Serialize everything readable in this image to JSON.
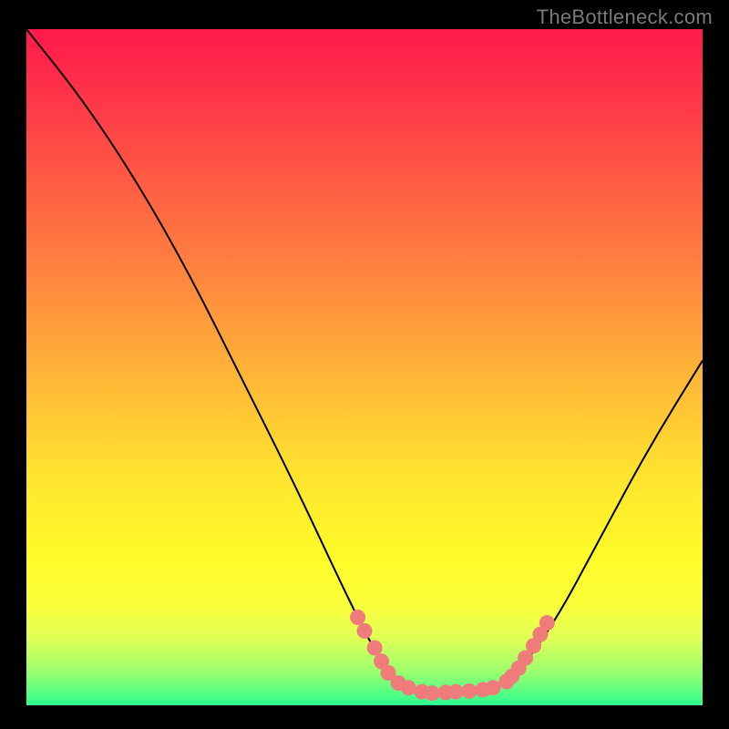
{
  "watermark": "TheBottleneck.com",
  "chart_data": {
    "type": "line",
    "title": "",
    "xlabel": "",
    "ylabel": "",
    "xlim": [
      0,
      100
    ],
    "ylim": [
      0,
      100
    ],
    "curve": [
      {
        "x": 0,
        "y": 100
      },
      {
        "x": 8,
        "y": 90
      },
      {
        "x": 16,
        "y": 78
      },
      {
        "x": 24,
        "y": 64
      },
      {
        "x": 32,
        "y": 48
      },
      {
        "x": 40,
        "y": 32
      },
      {
        "x": 47,
        "y": 17
      },
      {
        "x": 52,
        "y": 7
      },
      {
        "x": 56,
        "y": 2.5
      },
      {
        "x": 60,
        "y": 1.8
      },
      {
        "x": 64,
        "y": 2.0
      },
      {
        "x": 68,
        "y": 2.4
      },
      {
        "x": 72,
        "y": 4
      },
      {
        "x": 78,
        "y": 12
      },
      {
        "x": 85,
        "y": 25
      },
      {
        "x": 92,
        "y": 38
      },
      {
        "x": 100,
        "y": 51
      }
    ],
    "highlight_dots": [
      {
        "x": 49,
        "y": 13
      },
      {
        "x": 50,
        "y": 11
      },
      {
        "x": 51.5,
        "y": 8.5
      },
      {
        "x": 52.5,
        "y": 6.5
      },
      {
        "x": 53.5,
        "y": 4.8
      },
      {
        "x": 55,
        "y": 3.3
      },
      {
        "x": 56.5,
        "y": 2.6
      },
      {
        "x": 58.5,
        "y": 2.0
      },
      {
        "x": 60,
        "y": 1.8
      },
      {
        "x": 62,
        "y": 1.9
      },
      {
        "x": 63.5,
        "y": 2.0
      },
      {
        "x": 65.5,
        "y": 2.1
      },
      {
        "x": 67.5,
        "y": 2.3
      },
      {
        "x": 69,
        "y": 2.6
      },
      {
        "x": 71,
        "y": 3.5
      },
      {
        "x": 71.8,
        "y": 4.3
      },
      {
        "x": 72.8,
        "y": 5.5
      },
      {
        "x": 73.8,
        "y": 7.0
      },
      {
        "x": 75,
        "y": 8.8
      },
      {
        "x": 76,
        "y": 10.5
      },
      {
        "x": 77,
        "y": 12.2
      }
    ],
    "dot_color": "#ef7b7b",
    "curve_color": "#000000"
  }
}
